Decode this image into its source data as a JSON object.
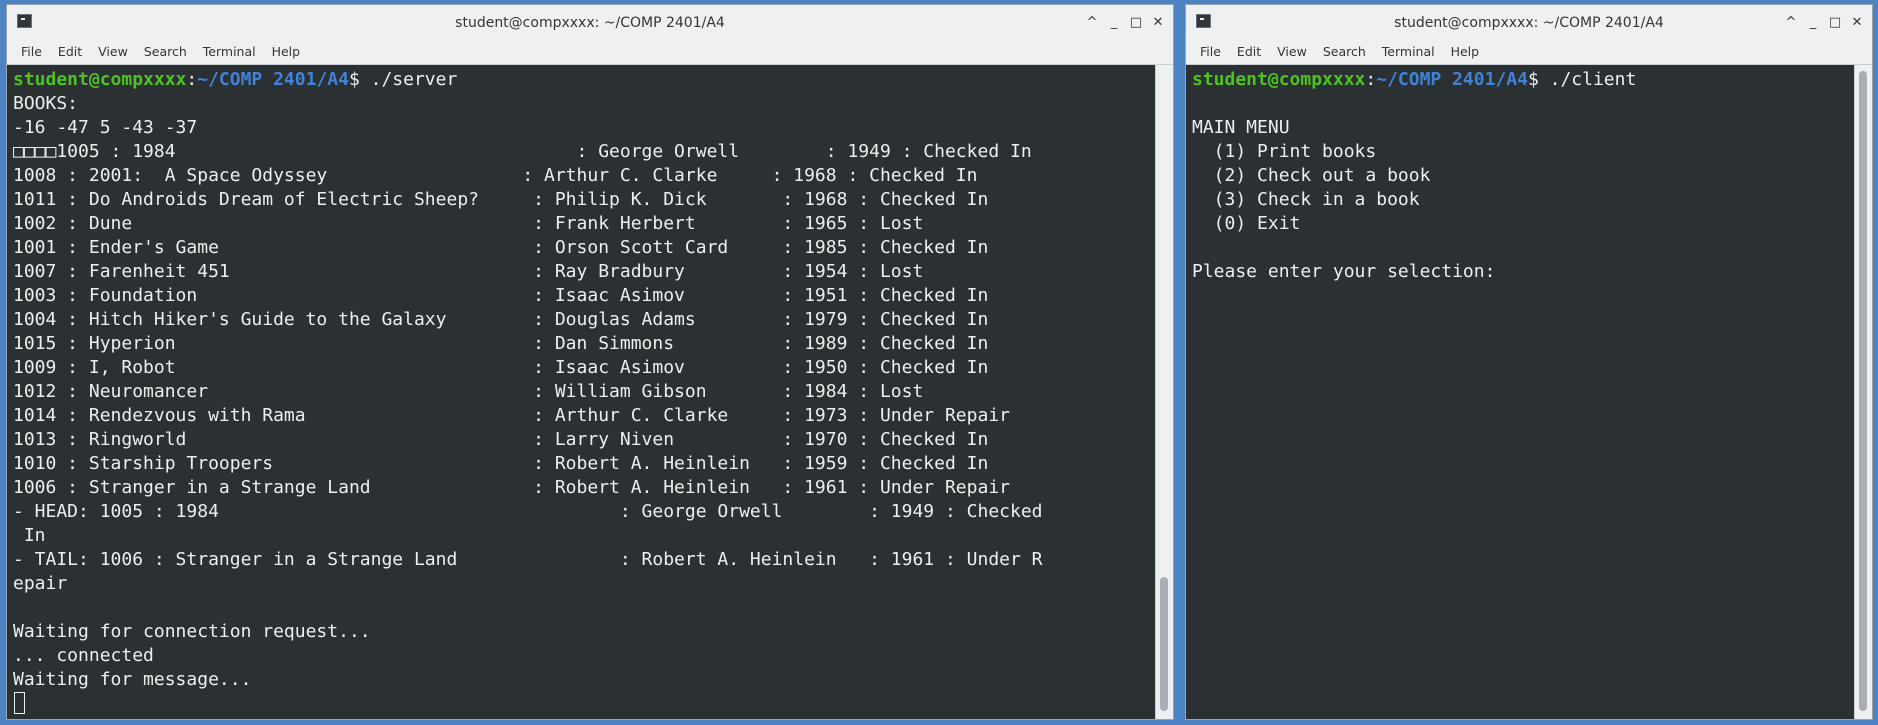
{
  "left_window": {
    "title": "student@compxxxx: ~/COMP 2401/A4",
    "menu": [
      "File",
      "Edit",
      "View",
      "Search",
      "Terminal",
      "Help"
    ],
    "prompt_user": "student@compxxxx",
    "prompt_path": "~/COMP 2401/A4",
    "prompt_suffix": "$ ./server",
    "output": "BOOKS:\n-16 -47 5 -43 -37\n□□□□1005 : 1984                                     : George Orwell        : 1949 : Checked In\n1008 : 2001:  A Space Odyssey                  : Arthur C. Clarke     : 1968 : Checked In\n1011 : Do Androids Dream of Electric Sheep?     : Philip K. Dick       : 1968 : Checked In\n1002 : Dune                                     : Frank Herbert        : 1965 : Lost\n1001 : Ender's Game                             : Orson Scott Card     : 1985 : Checked In\n1007 : Farenheit 451                            : Ray Bradbury         : 1954 : Lost\n1003 : Foundation                               : Isaac Asimov         : 1951 : Checked In\n1004 : Hitch Hiker's Guide to the Galaxy        : Douglas Adams        : 1979 : Checked In\n1015 : Hyperion                                 : Dan Simmons          : 1989 : Checked In\n1009 : I, Robot                                 : Isaac Asimov         : 1950 : Checked In\n1012 : Neuromancer                              : William Gibson       : 1984 : Lost\n1014 : Rendezvous with Rama                     : Arthur C. Clarke     : 1973 : Under Repair\n1013 : Ringworld                                : Larry Niven          : 1970 : Checked In\n1010 : Starship Troopers                        : Robert A. Heinlein   : 1959 : Checked In\n1006 : Stranger in a Strange Land               : Robert A. Heinlein   : 1961 : Under Repair\n- HEAD: 1005 : 1984                                     : George Orwell        : 1949 : Checked\n In\n- TAIL: 1006 : Stranger in a Strange Land               : Robert A. Heinlein   : 1961 : Under R\nepair\n\nWaiting for connection request...\n... connected\nWaiting for message..."
  },
  "right_window": {
    "title": "student@compxxxx: ~/COMP 2401/A4",
    "menu": [
      "File",
      "Edit",
      "View",
      "Search",
      "Terminal",
      "Help"
    ],
    "prompt_user": "student@compxxxx",
    "prompt_path": "~/COMP 2401/A4",
    "prompt_suffix": "$ ./client",
    "output": "\nMAIN MENU\n  (1) Print books\n  (2) Check out a book\n  (3) Check in a book\n  (0) Exit\n\nPlease enter your selection:"
  },
  "window_controls": {
    "keep_above": "^",
    "minimize": "_",
    "maximize": "□",
    "close": "✕"
  },
  "colors": {
    "terminal_bg": "#2b3033",
    "terminal_fg": "#ebefef",
    "prompt_user": "#4ec21f",
    "prompt_path": "#3f82d8",
    "chrome": "#eff0f1",
    "desktop": "#4d82c4"
  }
}
